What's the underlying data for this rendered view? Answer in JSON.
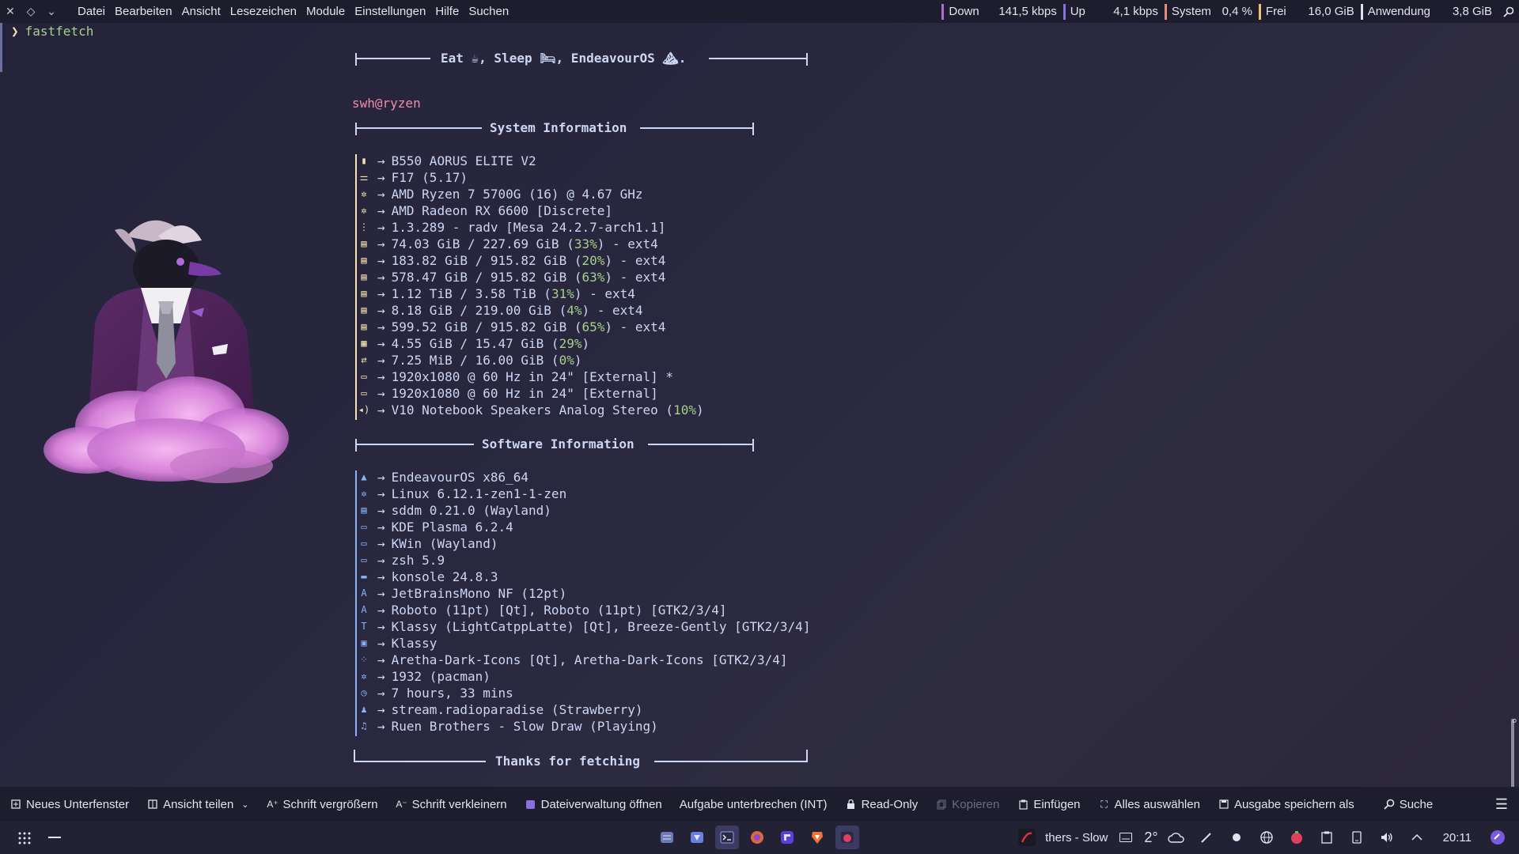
{
  "topbar": {
    "menu": [
      "Datei",
      "Bearbeiten",
      "Ansicht",
      "Lesezeichen",
      "Module",
      "Einstellungen",
      "Hilfe",
      "Suchen"
    ],
    "monitors": [
      {
        "label": "Down",
        "value": "141,5 kbps",
        "color": "#b06ad8"
      },
      {
        "label": "Up",
        "value": "4,1 kbps",
        "color": "#8a6fe0"
      },
      {
        "label": "System",
        "value": "0,4 %",
        "color": "#e88a7a"
      },
      {
        "label": "Frei",
        "value": "16,0 GiB",
        "color": "#f0c070"
      },
      {
        "label": "Anwendung",
        "value": "3,8 GiB",
        "color": "#e0e0e8"
      }
    ]
  },
  "terminal": {
    "prompt_symbol": "❯",
    "command": "fastfetch",
    "header": "Eat ☕, Sleep 🛏, EndeavourOS ⛰.",
    "user_host": "swh@ryzen",
    "system_title": "System Information",
    "software_title": "Software Information",
    "footer_title": "Thanks for fetching",
    "arrow": "→",
    "system": [
      {
        "text": "B550 AORUS ELITE V2"
      },
      {
        "text": "F17 (5.17)"
      },
      {
        "text": "AMD Ryzen 7 5700G (16) @ 4.67 GHz"
      },
      {
        "text": "AMD Radeon RX 6600 [Discrete]"
      },
      {
        "text": "1.3.289 - radv [Mesa 24.2.7-arch1.1]"
      },
      {
        "pre": "74.03 GiB / 227.69 GiB (",
        "pct": "33%",
        "post": ") - ext4"
      },
      {
        "pre": "183.82 GiB / 915.82 GiB (",
        "pct": "20%",
        "post": ") - ext4"
      },
      {
        "pre": "578.47 GiB / 915.82 GiB (",
        "pct": "63%",
        "post": ") - ext4"
      },
      {
        "pre": "1.12 TiB / 3.58 TiB (",
        "pct": "31%",
        "post": ") - ext4"
      },
      {
        "pre": "8.18 GiB / 219.00 GiB (",
        "pct": "4%",
        "post": ") - ext4"
      },
      {
        "pre": "599.52 GiB / 915.82 GiB (",
        "pct": "65%",
        "post": ") - ext4"
      },
      {
        "pre": "4.55 GiB / 15.47 GiB (",
        "pct": "29%",
        "post": ")"
      },
      {
        "pre": "7.25 MiB / 16.00 GiB (",
        "pct": "0%",
        "post": ")"
      },
      {
        "text": "1920x1080 @ 60 Hz in 24\" [External] *"
      },
      {
        "text": "1920x1080 @ 60 Hz in 24\" [External]"
      },
      {
        "pre": "V10 Notebook Speakers Analog Stereo (",
        "pct": "10%",
        "post": ")"
      }
    ],
    "software": [
      {
        "text": "EndeavourOS x86_64"
      },
      {
        "text": "Linux 6.12.1-zen1-1-zen"
      },
      {
        "text": "sddm 0.21.0 (Wayland)"
      },
      {
        "text": "KDE Plasma 6.2.4"
      },
      {
        "text": "KWin (Wayland)"
      },
      {
        "text": "zsh 5.9"
      },
      {
        "text": "konsole 24.8.3"
      },
      {
        "text": "JetBrainsMono NF (12pt)"
      },
      {
        "text": "Roboto (11pt) [Qt], Roboto (11pt) [GTK2/3/4]"
      },
      {
        "text": "Klassy (LightCatppLatte) [Qt], Breeze-Gently [GTK2/3/4]"
      },
      {
        "text": "Klassy"
      },
      {
        "text": "Aretha-Dark-Icons [Qt], Aretha-Dark-Icons [GTK2/3/4]"
      },
      {
        "text": "1932 (pacman)"
      },
      {
        "text": "7 hours, 33 mins"
      },
      {
        "text": "stream.radioparadise (Strawberry)"
      },
      {
        "text": "Ruen Brothers - Slow Draw (Playing)"
      }
    ],
    "sys_icon_color": "#f9e2af",
    "soft_icon_color": "#89b4fa",
    "pct_color": "#a6d189",
    "user_color": "#f38ba8",
    "color_dots": [
      "#bac2de",
      "#89b4fa",
      "#94e2d5",
      "#f5c2e7",
      "#89b4fa",
      "#f9e2af",
      "#a6e3a1",
      "#f38ba8"
    ]
  },
  "toolbar": {
    "items": [
      {
        "label": "Neues Unterfenster",
        "icon": "new-tab-icon",
        "disabled": false
      },
      {
        "label": "Ansicht teilen",
        "icon": "split-view-icon",
        "disabled": false
      },
      {
        "label": "Schrift vergrößern",
        "icon": "font-increase-icon",
        "disabled": false
      },
      {
        "label": "Schrift verkleinern",
        "icon": "font-decrease-icon",
        "disabled": false
      },
      {
        "label": "Dateiverwaltung öffnen",
        "icon": "file-manager-icon",
        "disabled": false
      },
      {
        "label": "Aufgabe unterbrechen (INT)",
        "icon": "",
        "disabled": false
      },
      {
        "label": "Read-Only",
        "icon": "lock-icon",
        "disabled": false
      },
      {
        "label": "Kopieren",
        "icon": "copy-icon",
        "disabled": true
      },
      {
        "label": "Einfügen",
        "icon": "paste-icon",
        "disabled": false
      },
      {
        "label": "Alles auswählen",
        "icon": "select-all-icon",
        "disabled": false
      },
      {
        "label": "Ausgabe speichern als",
        "icon": "save-icon",
        "disabled": false
      },
      {
        "label": "Suche",
        "icon": "search-icon",
        "disabled": false
      }
    ]
  },
  "panel": {
    "media_title": "thers - Slow",
    "temperature": "2°",
    "clock": "20:11"
  }
}
